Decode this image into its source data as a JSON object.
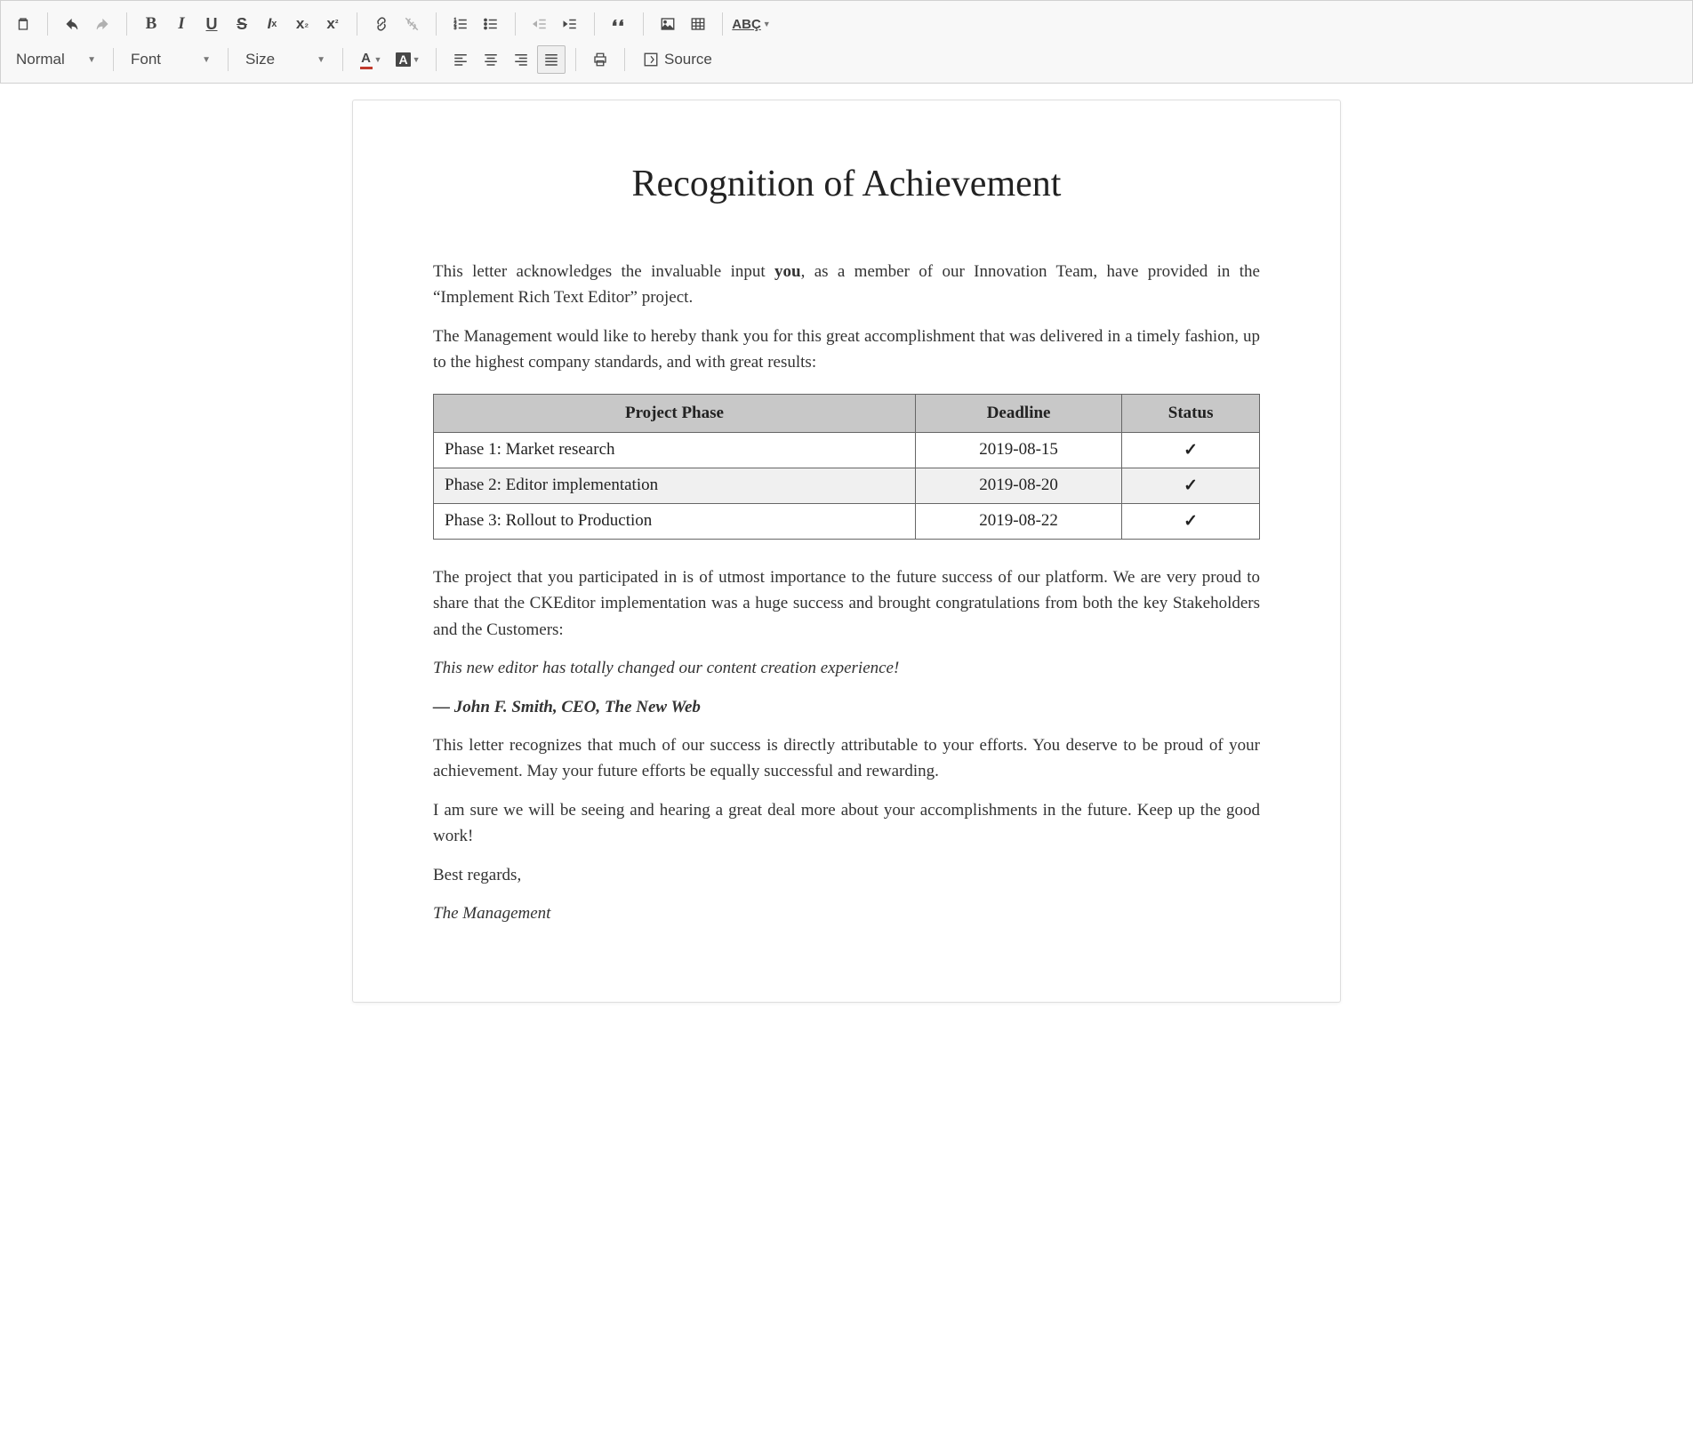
{
  "toolbar": {
    "paragraph_format": "Normal",
    "font_label": "Font",
    "size_label": "Size",
    "source_label": "Source"
  },
  "doc": {
    "title": "Recognition of Achievement",
    "intro_pre": "This letter acknowledges the invaluable input ",
    "intro_bold": "you",
    "intro_post": ", as a member of our Innovation Team, have provided in the “Implement Rich Text Editor” project.",
    "p2": "The Management would like to hereby thank you for this great accomplishment that was delivered in a timely fashion, up to the highest company standards, and with great results:",
    "table": {
      "headers": [
        "Project Phase",
        "Deadline",
        "Status"
      ],
      "rows": [
        {
          "phase": "Phase 1: Market research",
          "deadline": "2019-08-15",
          "status": "✓"
        },
        {
          "phase": "Phase 2: Editor implementation",
          "deadline": "2019-08-20",
          "status": "✓"
        },
        {
          "phase": "Phase 3: Rollout to Production",
          "deadline": "2019-08-22",
          "status": "✓"
        }
      ]
    },
    "p3": "The project that you participated in is of utmost importance to the future success of our platform. We are very proud to share that the CKEditor implementation was a huge success and brought congratulations from both the key Stakeholders and the Customers:",
    "quote": "This new editor has totally changed our content creation experience!",
    "quote_by": "— John F. Smith, CEO, The New Web",
    "p4": "This letter recognizes that much of our success is directly attributable to your efforts. You deserve to be proud of your achievement. May your future efforts be equally successful and rewarding.",
    "p5": "I am sure we will be seeing and hearing a great deal more about your accomplishments in the future. Keep up the good work!",
    "signoff": "Best regards,",
    "signoff_name": "The Management"
  }
}
